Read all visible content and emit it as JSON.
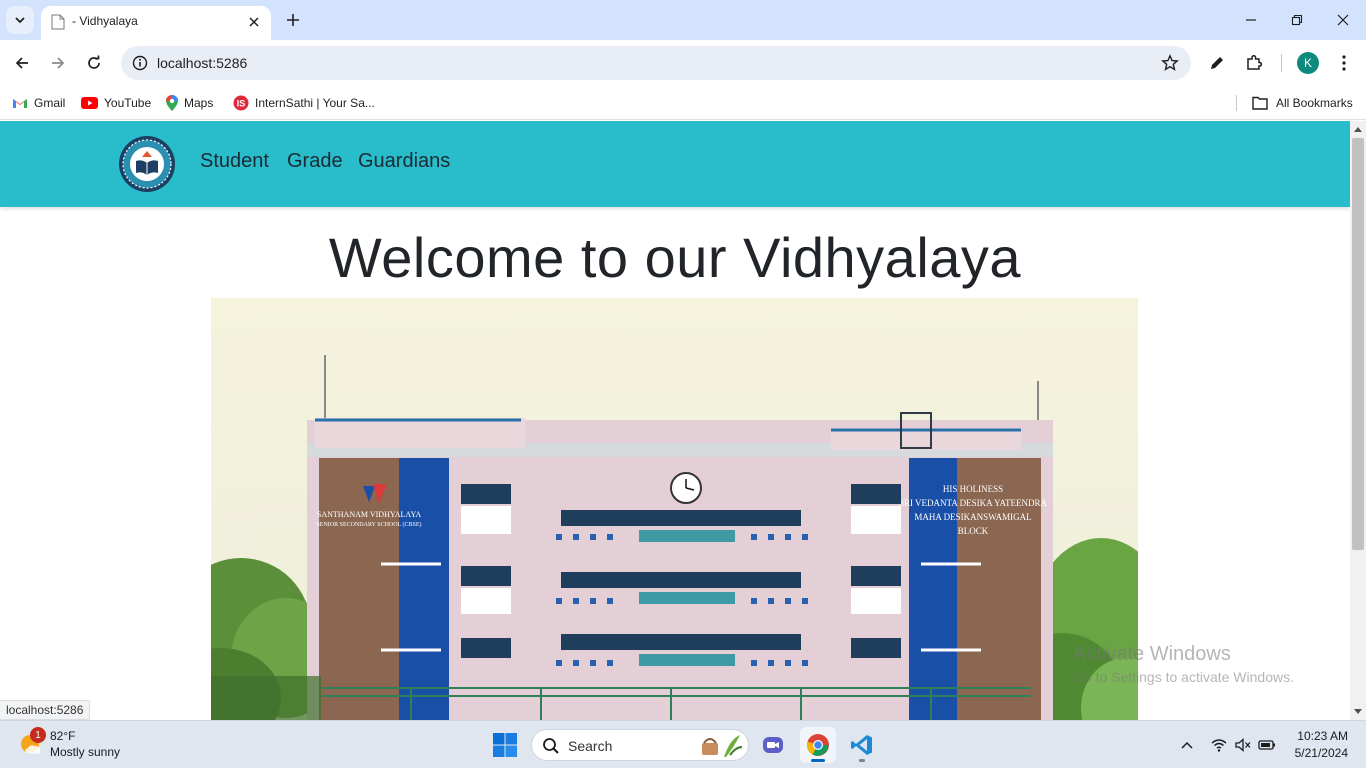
{
  "browser": {
    "tab_title": "- Vidhyalaya",
    "url": "localhost:5286",
    "bookmarks": [
      {
        "label": "Gmail",
        "icon": "gmail-icon"
      },
      {
        "label": "YouTube",
        "icon": "youtube-icon"
      },
      {
        "label": "Maps",
        "icon": "maps-icon"
      },
      {
        "label": "InternSathi | Your Sa...",
        "icon": "internsathi-icon"
      }
    ],
    "all_bookmarks": "All Bookmarks",
    "profile_initial": "K",
    "status_url": "localhost:5286"
  },
  "site": {
    "nav_links": [
      "Student",
      "Grade",
      "Guardians"
    ],
    "hero_title": "Welcome to our Vidhyalaya",
    "building_left_sign": [
      "SANTHANAM VIDHYALAYA",
      "SENIOR SECONDARY SCHOOL  (CBSE)"
    ],
    "building_right_sign": [
      "HIS HOLINESS",
      "SRI VEDANTA DESIKA YATEENDRA",
      "MAHA DESIKANSWAMIGAL",
      "BLOCK"
    ],
    "brand_color": "#29bccb"
  },
  "watermark": {
    "title": "Activate Windows",
    "subtitle": "Go to Settings to activate Windows."
  },
  "taskbar": {
    "weather_temp": "82°F",
    "weather_desc": "Mostly sunny",
    "weather_badge": "1",
    "search_label": "Search",
    "time": "10:23 AM",
    "date": "5/21/2024"
  }
}
